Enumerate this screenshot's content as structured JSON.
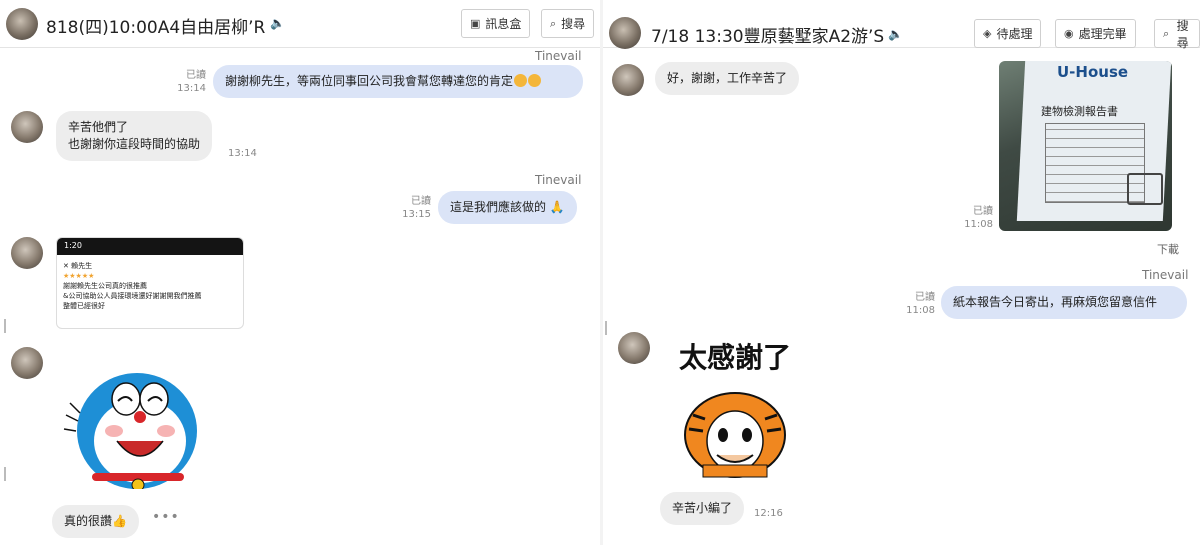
{
  "left": {
    "title": "818(四)10:00A4自由居柳’R",
    "buttons": {
      "inbox": "訊息盒",
      "search": "搜尋"
    },
    "messages": [
      {
        "sender": "Tinevail",
        "read": "已讀",
        "time": "13:14",
        "text": "謝謝柳先生，等兩位同事回公司我會幫您轉達您的肯定"
      },
      {
        "time": "13:14",
        "line1": "辛苦他們了",
        "line2": "也謝謝你這段時間的協助"
      },
      {
        "sender": "Tinevail",
        "read": "已讀",
        "time": "13:15",
        "text": "這是我們應該做的"
      },
      {
        "line1": "真的很讚"
      }
    ],
    "screenshot": {
      "clock": "1:20",
      "name": "賴先生",
      "review_line1": "謝謝賴先生公司真的很推薦",
      "review_line2": "&公司協助公人員接環境還好謝謝開我們推薦",
      "review_line3": "整體已經很好"
    },
    "more": "•••"
  },
  "right": {
    "title": "7/18 13:30豐原藝墅家A2游’S",
    "buttons": {
      "pending": "待處理",
      "done": "處理完畢",
      "search": "搜尋"
    },
    "messages": [
      {
        "text": "好，謝謝，工作辛苦了"
      },
      {
        "read": "已讀",
        "time": "11:08",
        "download": "下載"
      },
      {
        "sender": "Tinevail",
        "read": "已讀",
        "time": "11:08",
        "text": "紙本報告今日寄出，再麻煩您留意信件"
      },
      {
        "time": "12:16",
        "text": "辛苦小編了"
      }
    ],
    "report": {
      "logo": "U-House",
      "title": "建物檢測報告書"
    },
    "sticker_text": "太感謝了"
  },
  "colors": {
    "out_bubble": "#dbe4f7",
    "in_bubble": "#ededed",
    "tiger": "#f0871f"
  }
}
